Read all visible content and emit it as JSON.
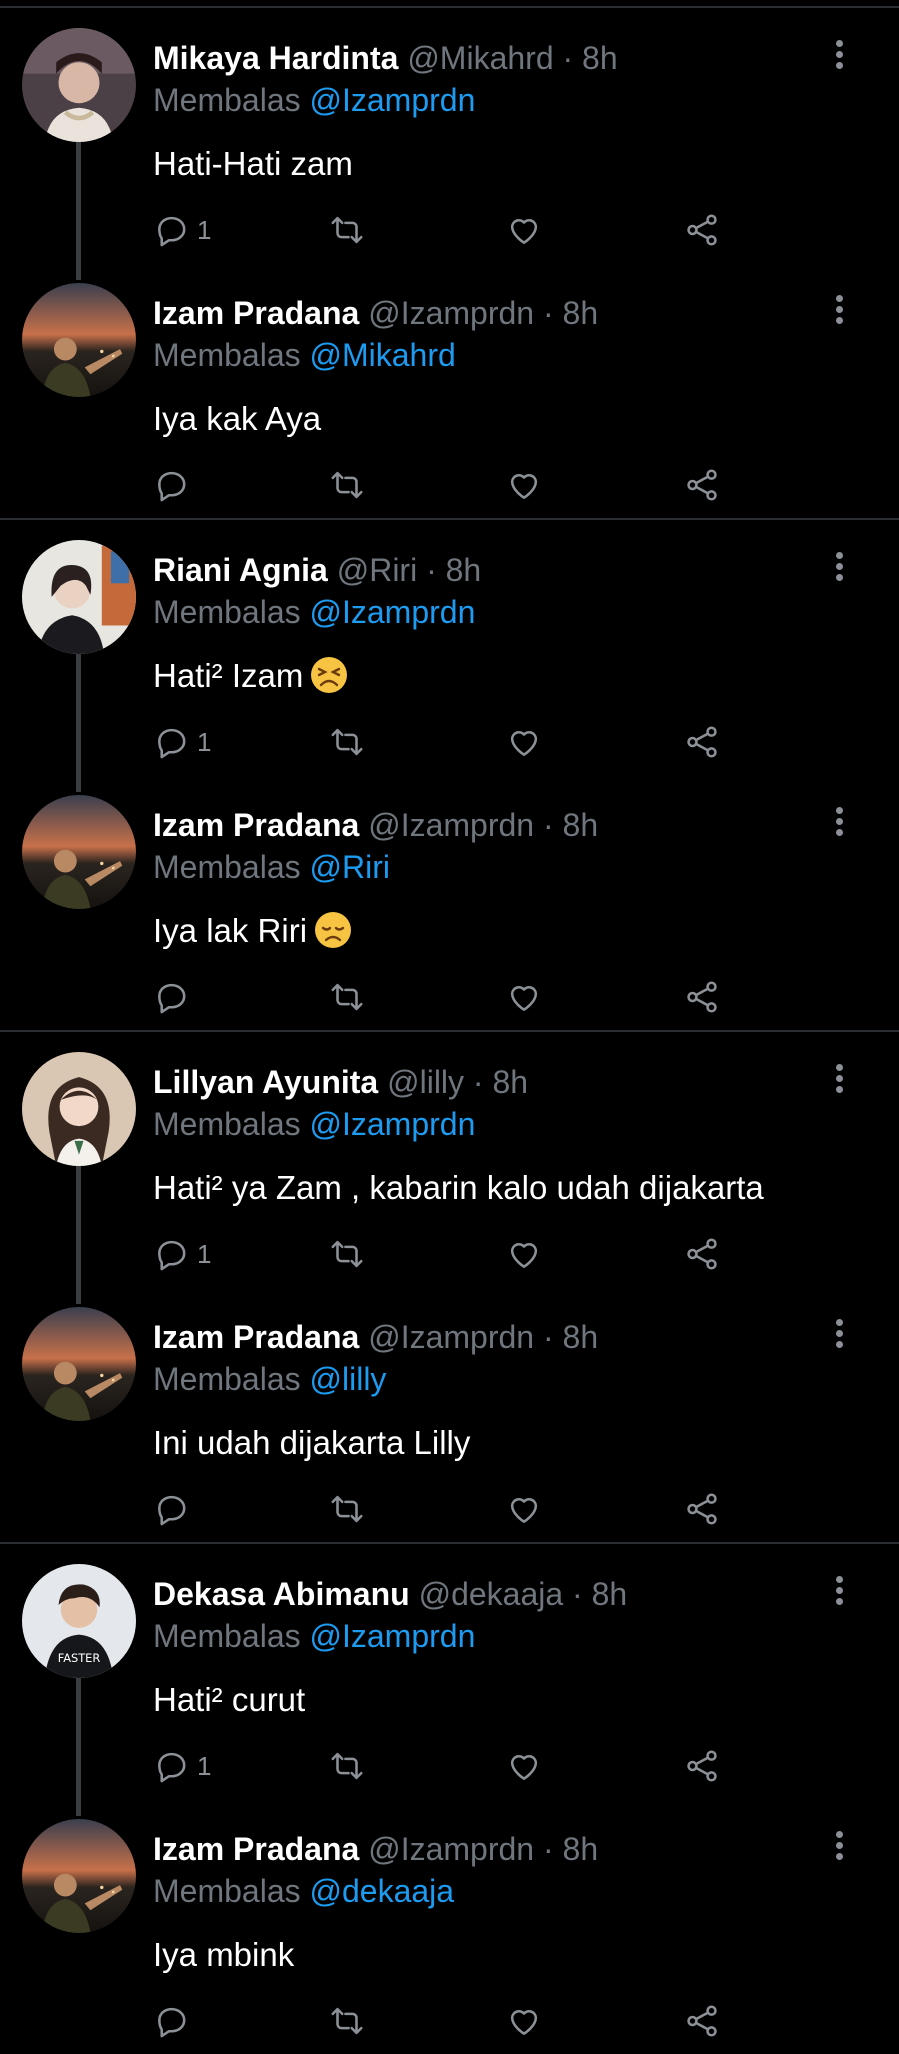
{
  "threads": [
    {
      "tweets": [
        {
          "name": "Mikaya Hardinta",
          "handle": "@Mikahrd",
          "time": "· 8h",
          "reply_prefix": "Membalas",
          "reply_to": "@Izamprdn",
          "text": "Hati-Hati zam",
          "emoji": "",
          "reply_count": "1",
          "avatar": "mikaya"
        },
        {
          "name": "Izam Pradana",
          "handle": "@Izamprdn",
          "time": "· 8h",
          "reply_prefix": "Membalas",
          "reply_to": "@Mikahrd",
          "text": "Iya kak Aya",
          "emoji": "",
          "reply_count": "",
          "avatar": "izam"
        }
      ]
    },
    {
      "tweets": [
        {
          "name": "Riani Agnia",
          "handle": "@Riri",
          "time": "· 8h",
          "reply_prefix": "Membalas",
          "reply_to": "@Izamprdn",
          "text": "Hati² Izam",
          "emoji": "tired-face",
          "reply_count": "1",
          "avatar": "riani"
        },
        {
          "name": "Izam Pradana",
          "handle": "@Izamprdn",
          "time": "· 8h",
          "reply_prefix": "Membalas",
          "reply_to": "@Riri",
          "text": "Iya lak Riri",
          "emoji": "disappointed-face",
          "reply_count": "",
          "avatar": "izam"
        }
      ]
    },
    {
      "tweets": [
        {
          "name": "Lillyan Ayunita",
          "handle": "@lilly",
          "time": "· 8h",
          "reply_prefix": "Membalas",
          "reply_to": "@Izamprdn",
          "text": "Hati² ya Zam , kabarin kalo udah dijakarta",
          "emoji": "",
          "reply_count": "1",
          "avatar": "lillyan"
        },
        {
          "name": "Izam Pradana",
          "handle": "@Izamprdn",
          "time": "· 8h",
          "reply_prefix": "Membalas",
          "reply_to": "@lilly",
          "text": "Ini udah dijakarta Lilly",
          "emoji": "",
          "reply_count": "",
          "avatar": "izam"
        }
      ]
    },
    {
      "tweets": [
        {
          "name": "Dekasa Abimanu",
          "handle": "@dekaaja",
          "time": "· 8h",
          "reply_prefix": "Membalas",
          "reply_to": "@Izamprdn",
          "text": "Hati² curut",
          "emoji": "",
          "reply_count": "1",
          "avatar": "dekasa"
        },
        {
          "name": "Izam Pradana",
          "handle": "@Izamprdn",
          "time": "· 8h",
          "reply_prefix": "Membalas",
          "reply_to": "@dekaaja",
          "text": "Iya mbink",
          "emoji": "",
          "reply_count": "",
          "avatar": "izam"
        }
      ]
    }
  ],
  "colors": {
    "background": "#000000",
    "text": "#ffffff",
    "muted": "#6f767d",
    "mention": "#1d9bf0",
    "divider": "#2b2f33"
  }
}
